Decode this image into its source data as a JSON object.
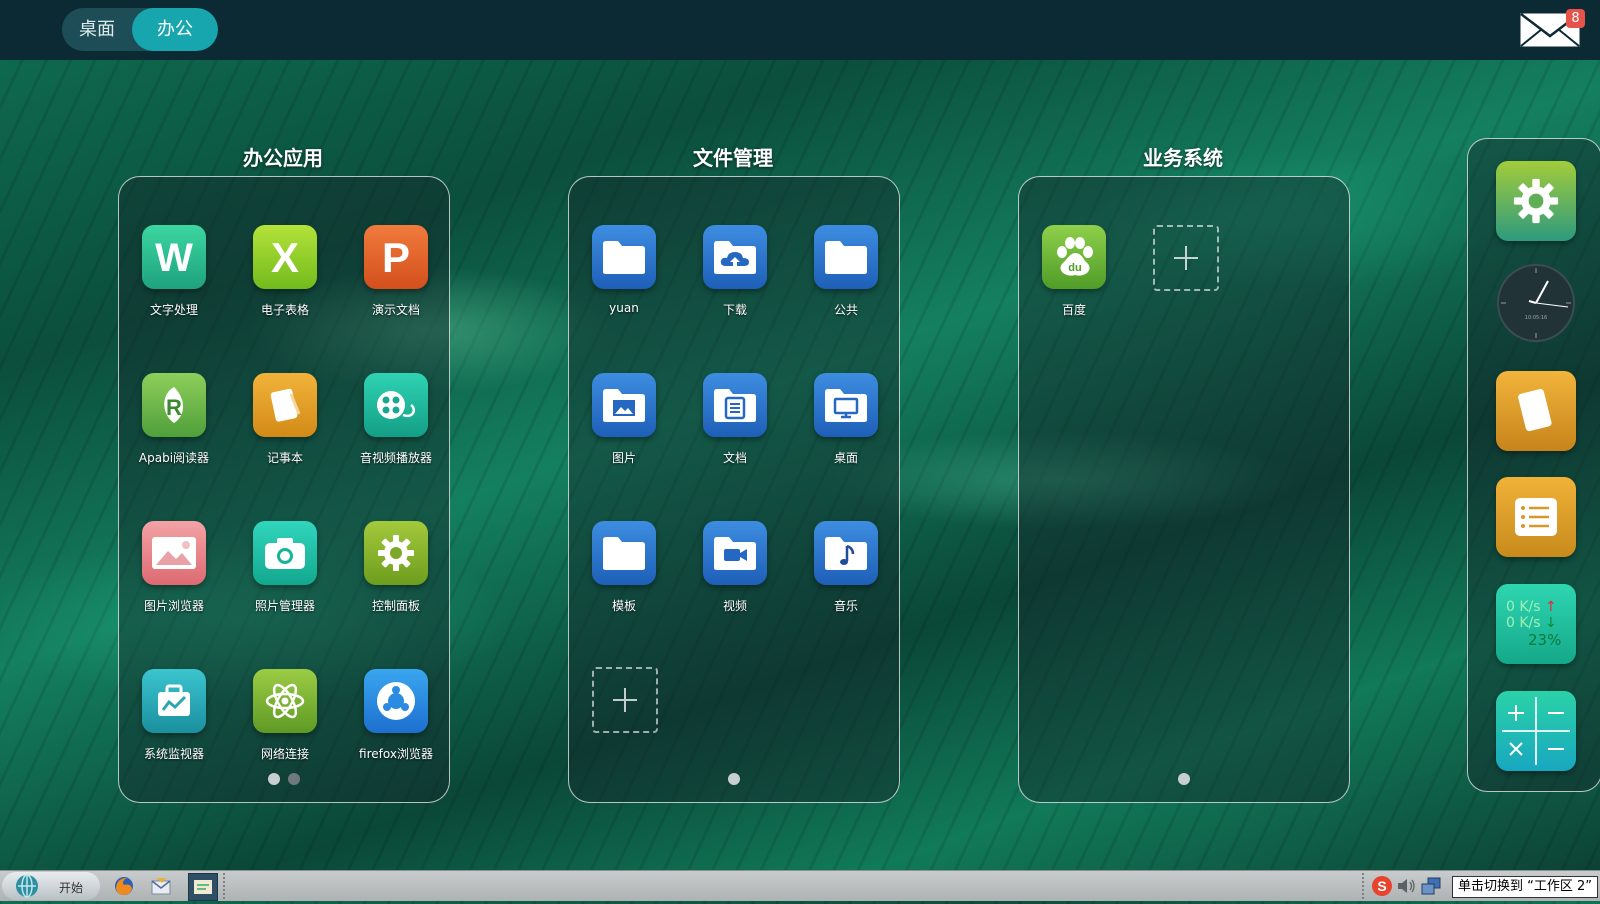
{
  "topbar": {
    "tabs": [
      {
        "label": "桌面",
        "active": false
      },
      {
        "label": "办公",
        "active": true
      }
    ],
    "mail_badge": "8"
  },
  "panels": [
    {
      "title": "办公应用",
      "apps": [
        {
          "label": "文字处理",
          "icon": "word-icon"
        },
        {
          "label": "电子表格",
          "icon": "spreadsheet-icon"
        },
        {
          "label": "演示文档",
          "icon": "presentation-icon"
        },
        {
          "label": "Apabi阅读器",
          "icon": "apabi-reader-icon"
        },
        {
          "label": "记事本",
          "icon": "notepad-icon"
        },
        {
          "label": "音视频播放器",
          "icon": "media-player-icon"
        },
        {
          "label": "图片浏览器",
          "icon": "image-viewer-icon"
        },
        {
          "label": "照片管理器",
          "icon": "camera-icon"
        },
        {
          "label": "控制面板",
          "icon": "gear-icon"
        },
        {
          "label": "系统监视器",
          "icon": "system-monitor-icon"
        },
        {
          "label": "网络连接",
          "icon": "atom-icon"
        },
        {
          "label": "firefox浏览器",
          "icon": "browser-icon"
        }
      ],
      "pages": 2,
      "current_page": 1
    },
    {
      "title": "文件管理",
      "apps": [
        {
          "label": "yuan",
          "icon": "folder-icon"
        },
        {
          "label": "下载",
          "icon": "cloud-download-folder-icon"
        },
        {
          "label": "公共",
          "icon": "folder-icon"
        },
        {
          "label": "图片",
          "icon": "picture-folder-icon"
        },
        {
          "label": "文档",
          "icon": "document-folder-icon"
        },
        {
          "label": "桌面",
          "icon": "desktop-folder-icon"
        },
        {
          "label": "模板",
          "icon": "folder-icon"
        },
        {
          "label": "视频",
          "icon": "video-folder-icon"
        },
        {
          "label": "音乐",
          "icon": "music-folder-icon"
        }
      ],
      "pages": 1,
      "current_page": 1
    },
    {
      "title": "业务系统",
      "apps": [
        {
          "label": "百度",
          "icon": "baidu-paw-icon"
        }
      ],
      "pages": 1,
      "current_page": 1
    }
  ],
  "dock": {
    "widgets": [
      "settings-icon",
      "clock-icon",
      "note-icon",
      "list-icon",
      "network-monitor-icon",
      "calculator-icon"
    ],
    "clock_text": "10:05:16",
    "net_up": "0 K/s",
    "net_down": "0 K/s",
    "cpu": "23%"
  },
  "taskbar": {
    "start_label": "开始",
    "workspace_button": "单击切换到 “工作区 2”"
  },
  "colors": {
    "accent": "#17a6ad",
    "topbar": "#0c2a33",
    "badge": "#e5534b"
  }
}
